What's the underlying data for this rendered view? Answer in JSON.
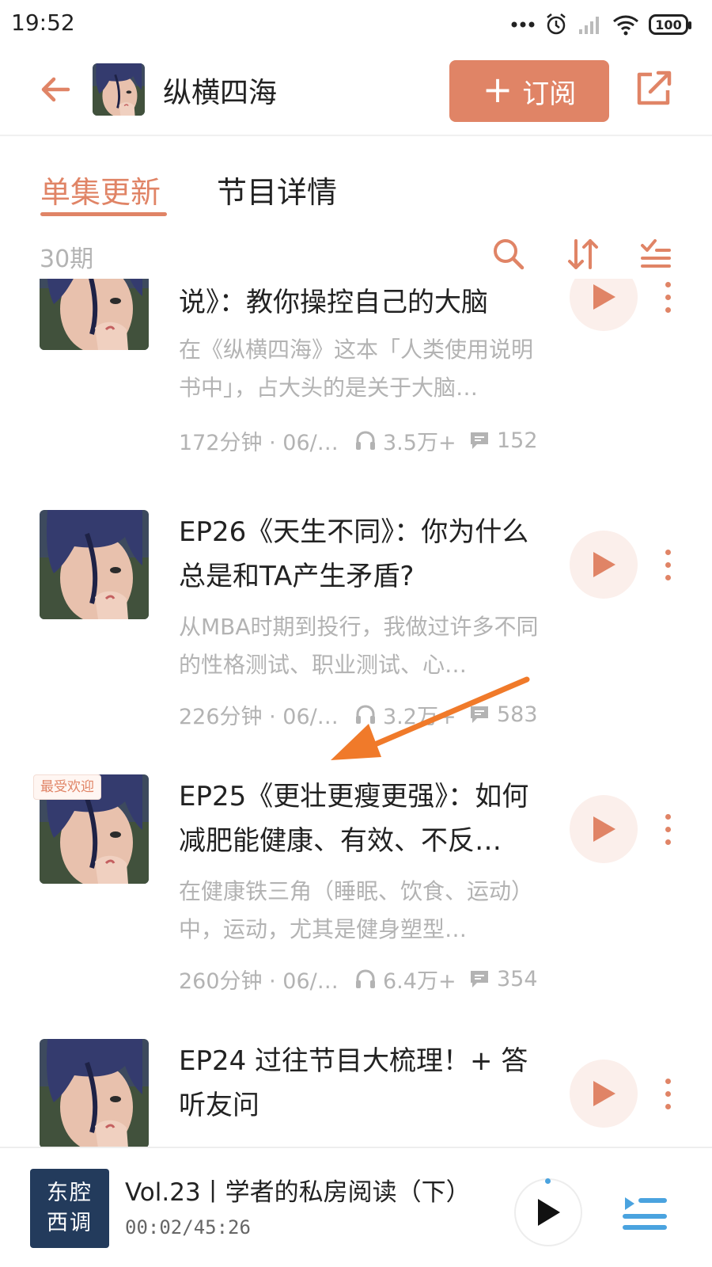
{
  "status_bar": {
    "time": "19:52",
    "battery": "100"
  },
  "header": {
    "title": "纵横四海",
    "subscribe_label": "订阅",
    "subscribe_plus": "+"
  },
  "tabs": [
    {
      "label": "单集更新",
      "active": true
    },
    {
      "label": "节目详情",
      "active": false
    }
  ],
  "list_toolbar": {
    "count": "30期"
  },
  "episodes": [
    {
      "title": "说》：教你操控自己的大脑",
      "description": "在《纵横四海》这本「人类使用说明书中」，占大头的是关于大脑…",
      "duration_date": "172分钟 · 06/…",
      "plays": "3.5万+",
      "comments": "152"
    },
    {
      "title": "EP26《天生不同》：你为什么总是和TA产生矛盾?",
      "description": "从MBA时期到投行，我做过许多不同的性格测试、职业测试、心…",
      "duration_date": "226分钟 · 06/…",
      "plays": "3.2万+",
      "comments": "583"
    },
    {
      "badge": "最受欢迎",
      "title": "EP25《更壮更瘦更强》：如何减肥能健康、有效、不反…",
      "description": "在健康铁三角（睡眠、饮食、运动）中，运动，尤其是健身塑型…",
      "duration_date": "260分钟 · 06/…",
      "plays": "6.4万+",
      "comments": "354"
    },
    {
      "title": "EP24 过往节目大梳理！+ 答听友问",
      "description": "",
      "duration_date": "",
      "plays": "",
      "comments": ""
    }
  ],
  "now_playing": {
    "cover_text_line1": "东腔",
    "cover_text_line2": "西调",
    "title": "Vol.23丨学者的私房阅读（下）",
    "time": "00:02/45:26"
  },
  "colors": {
    "accent": "#e08466",
    "muted_text": "#b3b3b3",
    "play_circle_bg": "#fbefeb",
    "annotation_arrow": "#f07a2a"
  },
  "icons": {
    "back": "arrow-left-icon",
    "share": "share-external-icon",
    "search": "search-icon",
    "sort": "sort-icon",
    "filter": "filter-list-icon",
    "play": "play-triangle-icon",
    "more": "more-vertical-dots-icon",
    "headphones": "headphones-icon",
    "comment": "comment-bubble-icon",
    "playlist": "playlist-icon"
  }
}
